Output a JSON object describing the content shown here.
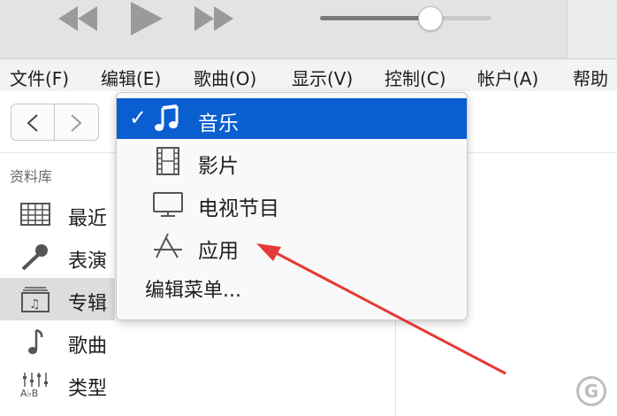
{
  "toolbar": {
    "volume_level": 0.64
  },
  "menubar": {
    "items": [
      "文件(F)",
      "编辑(E)",
      "歌曲(O)",
      "显示(V)",
      "控制(C)",
      "帐户(A)",
      "帮助"
    ]
  },
  "sidebar": {
    "title": "资料库",
    "items": [
      {
        "label": "最近",
        "icon": "grid-icon"
      },
      {
        "label": "表演",
        "icon": "microphone-icon"
      },
      {
        "label": "专辑",
        "icon": "album-icon"
      },
      {
        "label": "歌曲",
        "icon": "music-note-icon"
      },
      {
        "label": "类型",
        "icon": "genre-icon"
      }
    ]
  },
  "dropdown": {
    "check": "✓",
    "items": [
      {
        "label": "音乐",
        "icon": "music-note-icon",
        "selected": true
      },
      {
        "label": "影片",
        "icon": "film-icon",
        "selected": false
      },
      {
        "label": "电视节目",
        "icon": "tv-icon",
        "selected": false
      },
      {
        "label": "应用",
        "icon": "app-store-icon",
        "selected": false
      }
    ],
    "edit_label": "编辑菜单..."
  },
  "colors": {
    "selection": "#0a5fd0",
    "annotation_arrow": "#e53935"
  }
}
